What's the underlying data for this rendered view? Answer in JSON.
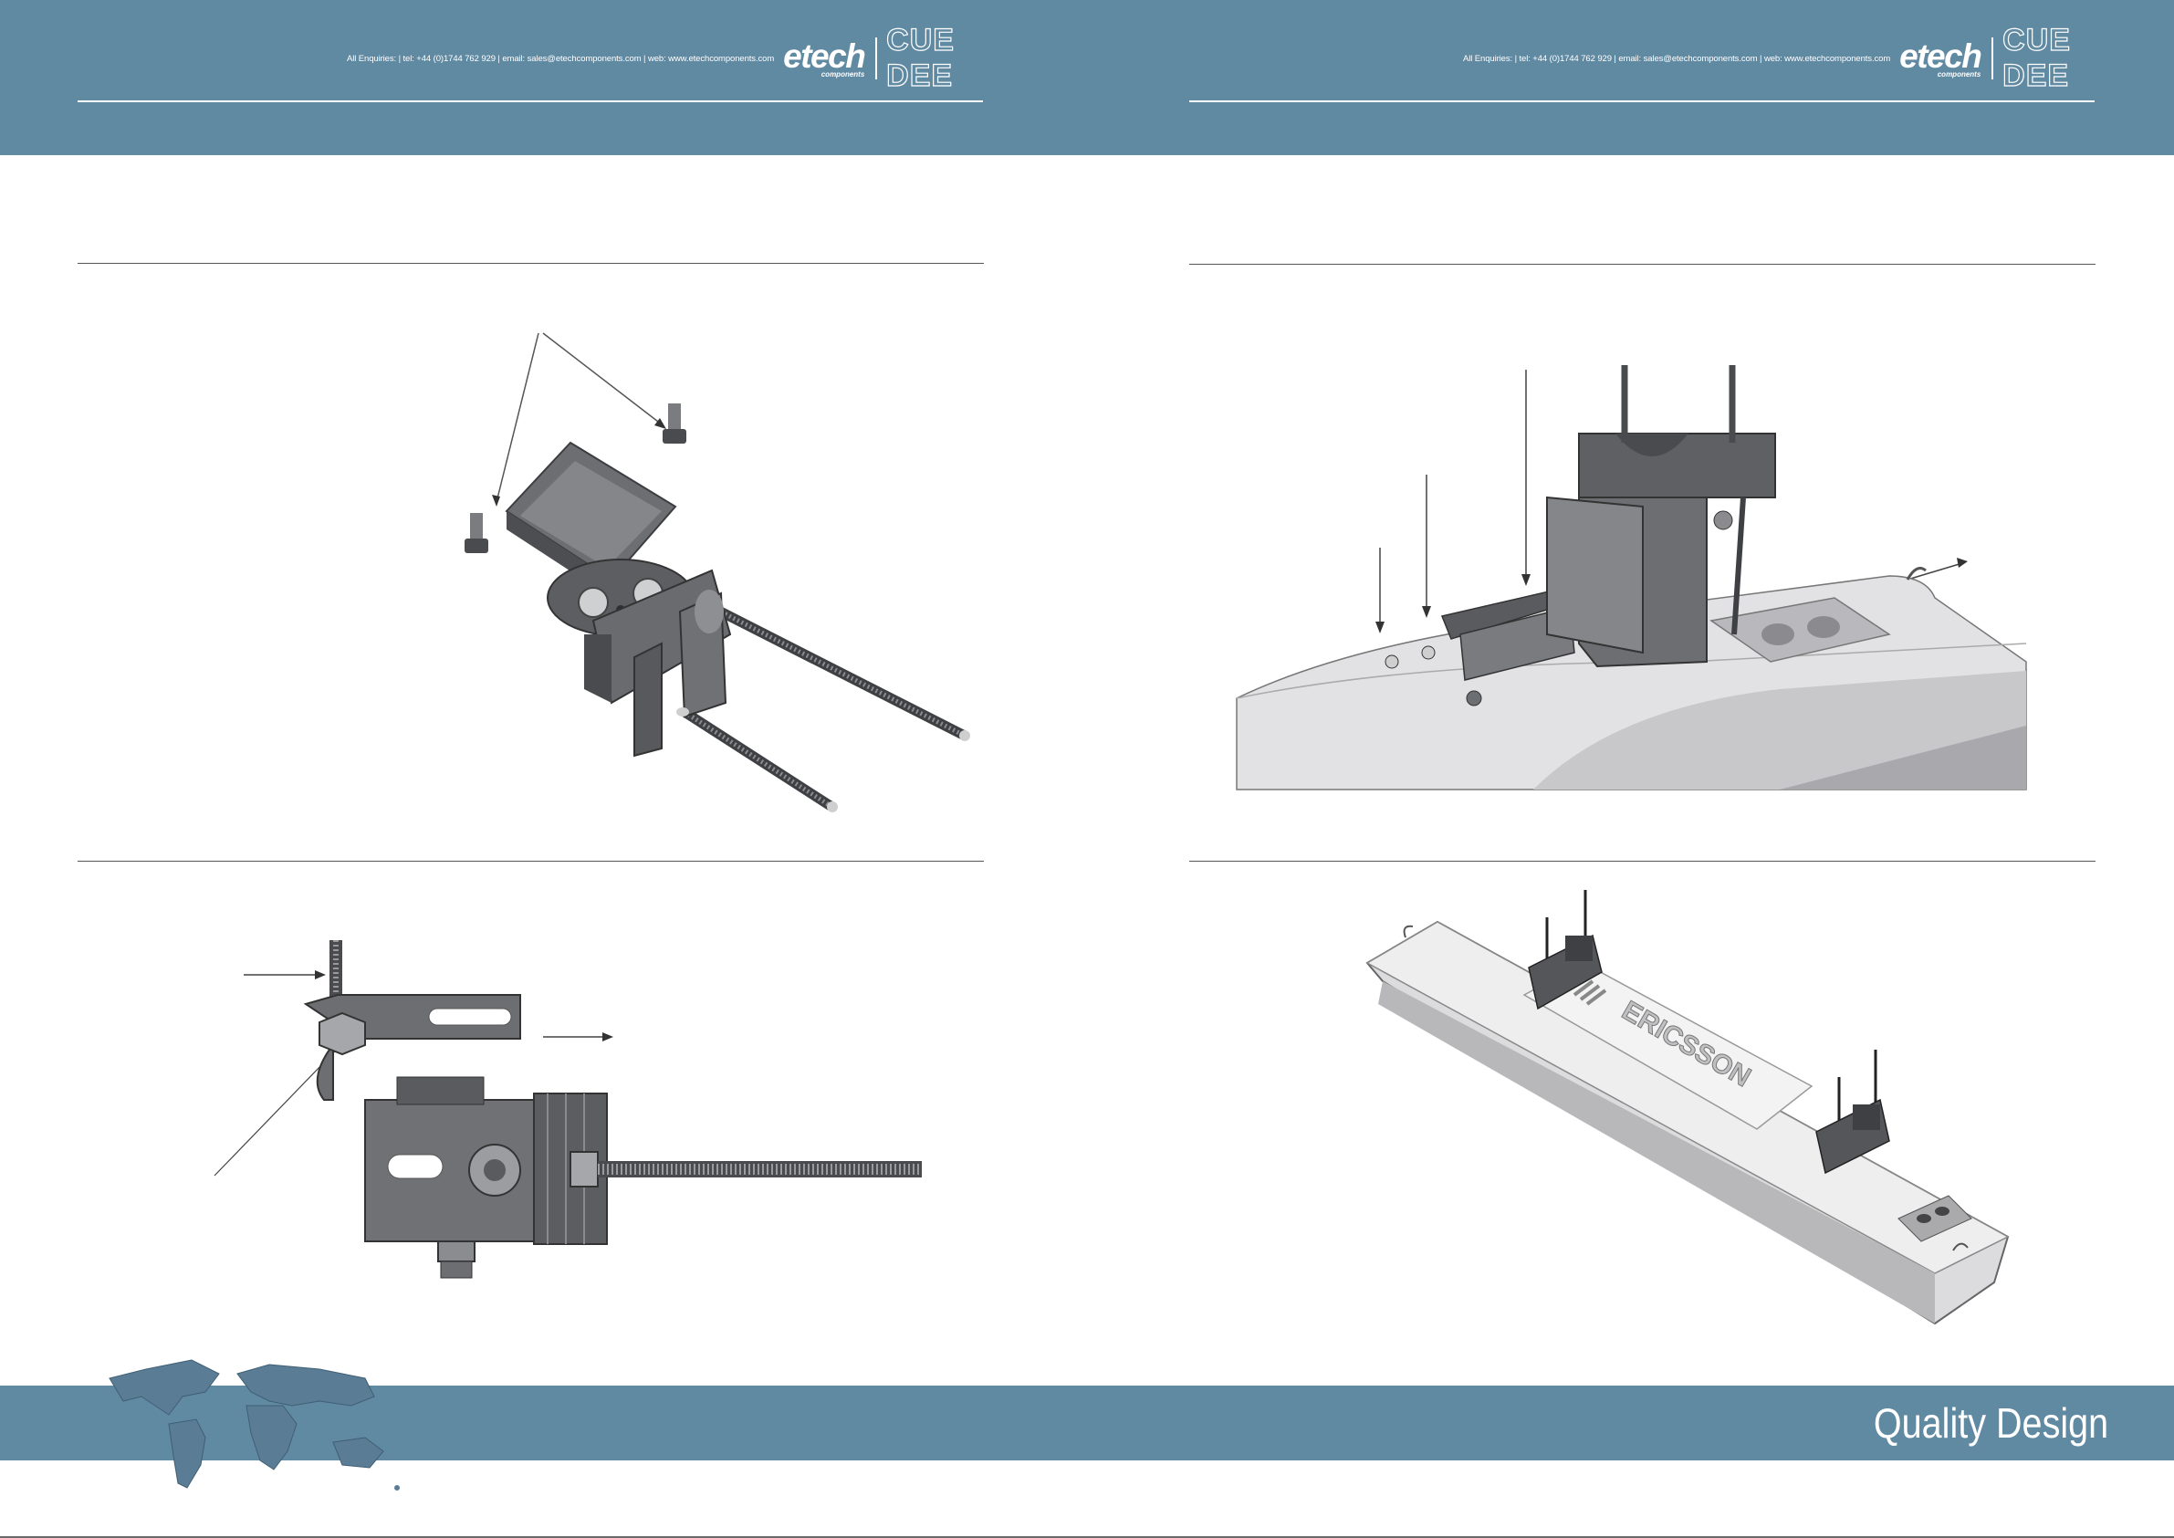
{
  "header": {
    "enquiries": "All Enquiries: | tel: +44 (0)1744 762 929 | email: sales@etechcomponents.com | web: www.etechcomponents.com",
    "etech_word": "etech",
    "etech_sub": "components",
    "cuedee": "CUE DEE"
  },
  "figures": {
    "ericsson_label": "ERICSSON"
  },
  "footer": {
    "title": "Quality Design"
  },
  "colors": {
    "band": "#6089a2",
    "metal": "#6d6e72",
    "metal_dark": "#45474b"
  }
}
